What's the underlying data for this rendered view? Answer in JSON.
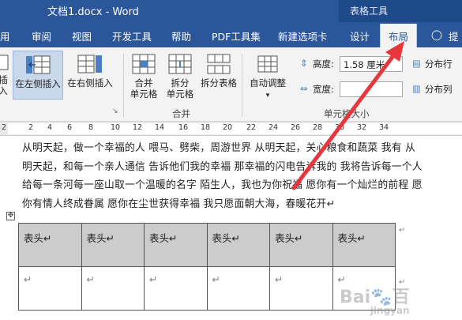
{
  "titlebar": {
    "doc_title": "文档1.docx  -  Word",
    "context_title": "表格工具"
  },
  "tabs": {
    "t0": "用",
    "t1": "审阅",
    "t2": "视图",
    "t3": "开发工具",
    "t4": "帮助",
    "t5": "PDF工具集",
    "t6": "新建选项卡",
    "t7": "设计",
    "t8": "布局",
    "t9": "提"
  },
  "ribbon": {
    "insert_below": "插入",
    "insert_left": "在左侧插入",
    "insert_right": "在右侧插入",
    "merge_cells": [
      "合并",
      "单元格"
    ],
    "split_cells": [
      "拆分",
      "单元格"
    ],
    "split_table": "拆分表格",
    "merge_group": "合并",
    "autofit": "自动调整",
    "height_label": "高度:",
    "height_value": "1.58 厘米",
    "width_label": "宽度:",
    "width_value": "",
    "distribute_rows": "分布行",
    "distribute_cols": "分布列",
    "cellsize_group": "单元格大小"
  },
  "ruler": {
    "ticks": [
      "2",
      "2",
      "4",
      "6",
      "8",
      "10",
      "12",
      "14",
      "16",
      "18",
      "20",
      "22",
      "24",
      "26",
      "28",
      "30",
      "32",
      "34"
    ]
  },
  "document": {
    "lines": [
      "从明天起，做一个幸福的人 喂马、劈柴，周游世界 从明天起，关心粮食和蔬菜 我有 从",
      "明天起，和每一个亲人通信 告诉他们我的幸福  那幸福的闪电告诉我的 我将告诉每一个人",
      "给每一条河每一座山取一个温暖的名字  陌生人，我也为你祝福  愿你有一个灿烂的前程  愿",
      "你有情人终成眷属 愿你在尘世获得幸福  我只愿面朝大海，春暖花开↵"
    ],
    "table_header": [
      "表头↵",
      "表头↵",
      "表头↵",
      "表头↵",
      "表头↵",
      "表头↵"
    ],
    "table_row2": [
      "↵",
      "↵",
      "↵",
      "↵",
      "↵",
      "↵"
    ],
    "row_end_mark": "↵"
  },
  "watermark": {
    "text": "Bai🐾百",
    "sub": "jingyan"
  },
  "colors": {
    "brand": "#2b579a",
    "arrow": "#e8363d",
    "header_fill": "#cccccc"
  }
}
